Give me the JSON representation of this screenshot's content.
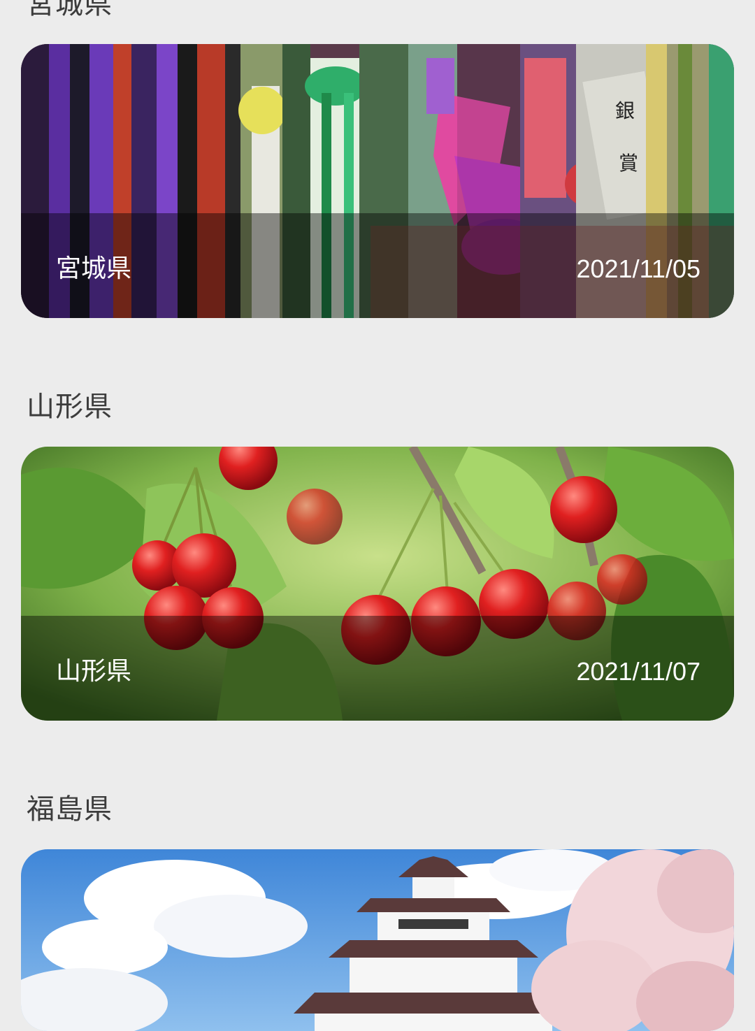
{
  "sections": [
    {
      "heading": "宮城県",
      "card": {
        "name": "宮城県",
        "date": "2021/11/05"
      }
    },
    {
      "heading": "山形県",
      "card": {
        "name": "山形県",
        "date": "2021/11/07"
      }
    },
    {
      "heading": "福島県",
      "card": {
        "name": "",
        "date": ""
      }
    }
  ],
  "colors": {
    "background": "#ececec",
    "heading": "#3c3c3c",
    "overlay_text": "#ffffff"
  }
}
